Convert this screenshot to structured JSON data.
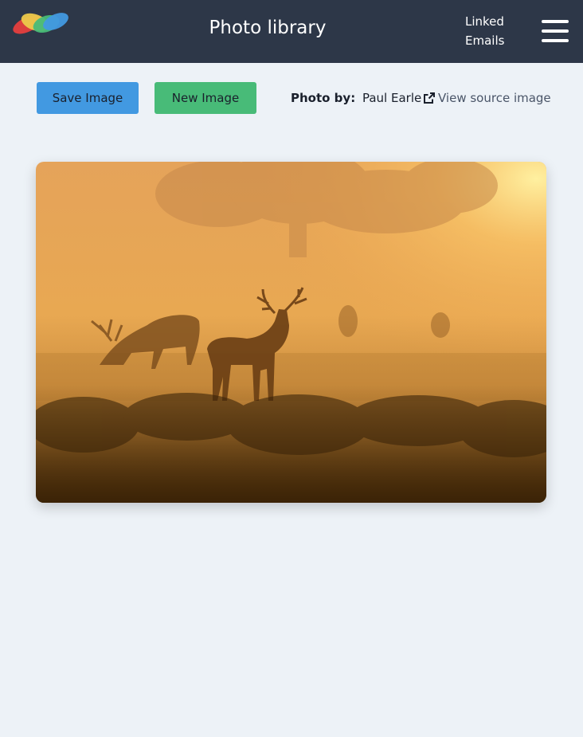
{
  "header": {
    "title": "Photo library",
    "linked_line1": "Linked",
    "linked_line2": "Emails",
    "logo_colors": [
      "#e53e3e",
      "#ecc94b",
      "#48bb78",
      "#4299e1"
    ],
    "background": "#2d3748"
  },
  "toolbar": {
    "save_label": "Save Image",
    "new_label": "New Image",
    "photo_by_label": "Photo by:",
    "photographer": "Paul Earle",
    "view_source_label": "View source image",
    "external_link_icon": "external-link-icon"
  },
  "colors": {
    "page_background": "#edf2f7",
    "save_button": "#4299e1",
    "new_button": "#48bb78"
  }
}
